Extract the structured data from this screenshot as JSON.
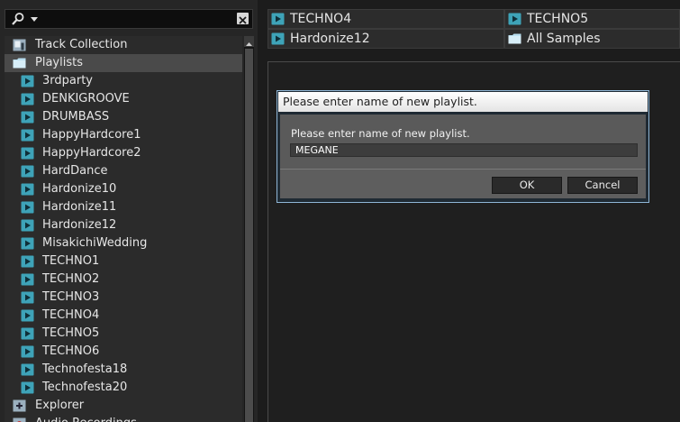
{
  "search": {
    "placeholder": "",
    "value": ""
  },
  "tree": {
    "items": [
      {
        "label": "Track Collection",
        "icon": "track-collection-icon",
        "level": 0,
        "selected": false
      },
      {
        "label": "Playlists",
        "icon": "folder-icon",
        "level": 0,
        "selected": true
      },
      {
        "label": "3rdparty",
        "icon": "playlist-icon",
        "level": 1,
        "selected": false
      },
      {
        "label": "DENKIGROOVE",
        "icon": "playlist-icon",
        "level": 1,
        "selected": false
      },
      {
        "label": "DRUMBASS",
        "icon": "playlist-icon",
        "level": 1,
        "selected": false
      },
      {
        "label": "HappyHardcore1",
        "icon": "playlist-icon",
        "level": 1,
        "selected": false
      },
      {
        "label": "HappyHardcore2",
        "icon": "playlist-icon",
        "level": 1,
        "selected": false
      },
      {
        "label": "HardDance",
        "icon": "playlist-icon",
        "level": 1,
        "selected": false
      },
      {
        "label": "Hardonize10",
        "icon": "playlist-icon",
        "level": 1,
        "selected": false
      },
      {
        "label": "Hardonize11",
        "icon": "playlist-icon",
        "level": 1,
        "selected": false
      },
      {
        "label": "Hardonize12",
        "icon": "playlist-icon",
        "level": 1,
        "selected": false
      },
      {
        "label": "MisakichiWedding",
        "icon": "playlist-icon",
        "level": 1,
        "selected": false
      },
      {
        "label": "TECHNO1",
        "icon": "playlist-icon",
        "level": 1,
        "selected": false
      },
      {
        "label": "TECHNO2",
        "icon": "playlist-icon",
        "level": 1,
        "selected": false
      },
      {
        "label": "TECHNO3",
        "icon": "playlist-icon",
        "level": 1,
        "selected": false
      },
      {
        "label": "TECHNO4",
        "icon": "playlist-icon",
        "level": 1,
        "selected": false
      },
      {
        "label": "TECHNO5",
        "icon": "playlist-icon",
        "level": 1,
        "selected": false
      },
      {
        "label": "TECHNO6",
        "icon": "playlist-icon",
        "level": 1,
        "selected": false
      },
      {
        "label": "Technofesta18",
        "icon": "playlist-icon",
        "level": 1,
        "selected": false
      },
      {
        "label": "Technofesta20",
        "icon": "playlist-icon",
        "level": 1,
        "selected": false
      },
      {
        "label": "Explorer",
        "icon": "explorer-icon",
        "level": 0,
        "selected": false
      },
      {
        "label": "Audio Recordings",
        "icon": "recordings-icon",
        "level": 0,
        "selected": false
      }
    ]
  },
  "favorites": [
    {
      "label": "TECHNO4",
      "icon": "playlist-icon"
    },
    {
      "label": "TECHNO5",
      "icon": "playlist-icon"
    },
    {
      "label": "Hardonize12",
      "icon": "playlist-icon"
    },
    {
      "label": "All Samples",
      "icon": "folder-icon"
    }
  ],
  "dialog": {
    "title": "Please enter name of new playlist.",
    "message": "Please enter name of new playlist.",
    "input_value": "MEGANE",
    "ok_label": "OK",
    "cancel_label": "Cancel"
  },
  "colors": {
    "playlist_icon": "#3ea3b8",
    "folder_icon": "#b9dff0",
    "selected_row": "#4a4a4a",
    "dialog_border": "#8fb6d6"
  }
}
